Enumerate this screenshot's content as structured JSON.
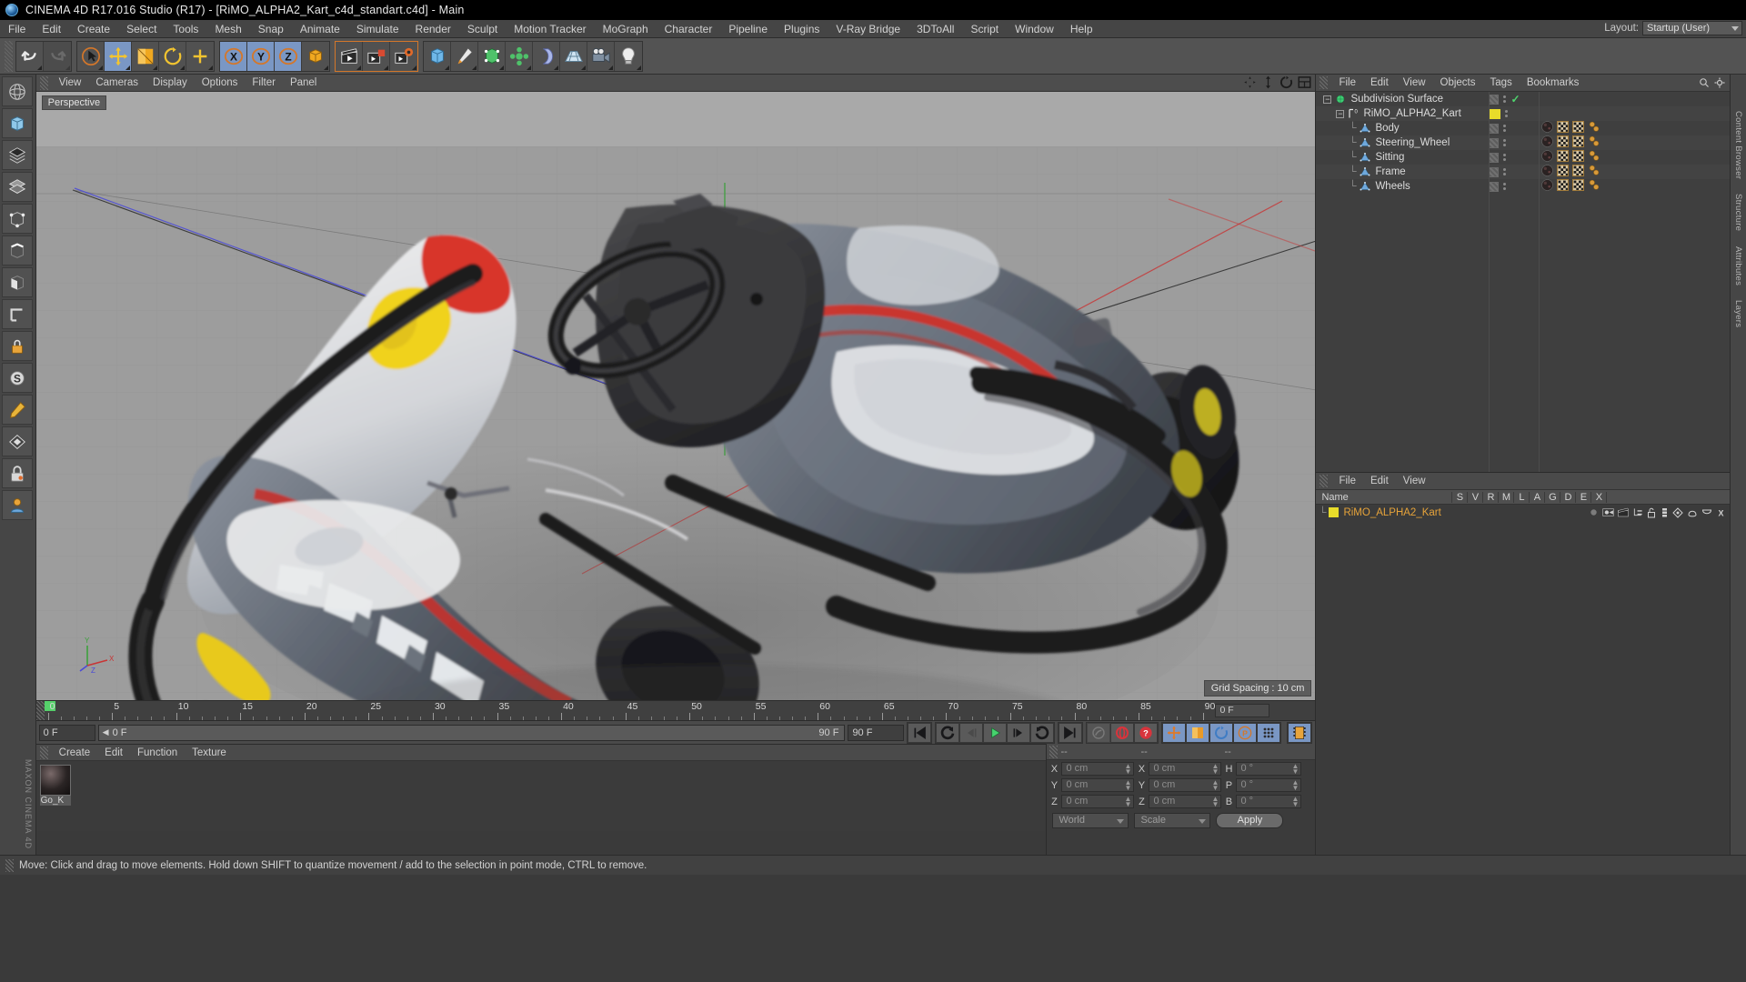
{
  "window": {
    "title": "CINEMA 4D R17.016 Studio (R17) - [RiMO_ALPHA2_Kart_c4d_standart.c4d] - Main",
    "app_icon": "c4d-logo-icon"
  },
  "menubar": {
    "items": [
      "File",
      "Edit",
      "Create",
      "Select",
      "Tools",
      "Mesh",
      "Snap",
      "Animate",
      "Simulate",
      "Render",
      "Sculpt",
      "Motion Tracker",
      "MoGraph",
      "Character",
      "Pipeline",
      "Plugins",
      "V-Ray Bridge",
      "3DToAll",
      "Script",
      "Window",
      "Help"
    ],
    "layout_label": "Layout:",
    "layout_value": "Startup (User)"
  },
  "toolbar": {
    "groups": [
      {
        "name": "history",
        "buttons": [
          {
            "name": "undo-button",
            "icon": "undo-arrow-icon"
          },
          {
            "name": "redo-button",
            "icon": "redo-arrow-icon"
          }
        ]
      },
      {
        "name": "transform",
        "buttons": [
          {
            "name": "select-tool-button",
            "icon": "cursor-arrow-icon"
          },
          {
            "name": "move-tool-button",
            "icon": "move-cross-icon",
            "active": true
          },
          {
            "name": "scale-tool-button",
            "icon": "scale-box-icon"
          },
          {
            "name": "rotate-tool-button",
            "icon": "rotate-circle-icon"
          },
          {
            "name": "axis-tool-button",
            "icon": "axis-cross-icon"
          }
        ]
      },
      {
        "name": "axis-lock",
        "buttons": [
          {
            "name": "lock-x-button",
            "icon": "x-axis-icon",
            "active": true
          },
          {
            "name": "lock-y-button",
            "icon": "y-axis-icon",
            "active": true
          },
          {
            "name": "lock-z-button",
            "icon": "z-axis-icon",
            "active": true
          },
          {
            "name": "world-coord-button",
            "icon": "world-cube-icon"
          }
        ]
      },
      {
        "name": "render",
        "buttons": [
          {
            "name": "render-view-button",
            "icon": "clapper-icon"
          },
          {
            "name": "render-to-picture-button",
            "icon": "clapper-picture-icon"
          },
          {
            "name": "render-settings-button",
            "icon": "clapper-gear-icon"
          }
        ]
      },
      {
        "name": "create",
        "buttons": [
          {
            "name": "add-cube-button",
            "icon": "cube-icon"
          },
          {
            "name": "spline-pen-button",
            "icon": "pen-icon"
          },
          {
            "name": "nurbs-button",
            "icon": "nurbs-green-icon"
          },
          {
            "name": "array-button",
            "icon": "array-green-icon"
          },
          {
            "name": "bend-deformer-button",
            "icon": "deformer-icon"
          },
          {
            "name": "floor-button",
            "icon": "floor-grid-icon"
          },
          {
            "name": "camera-button",
            "icon": "camera-icon"
          },
          {
            "name": "light-button",
            "icon": "lightbulb-icon"
          }
        ]
      }
    ]
  },
  "leftbar": {
    "buttons": [
      {
        "name": "live-selection-button",
        "icon": "sphere-mesh-icon"
      },
      {
        "name": "make-editable-button",
        "icon": "cube-editable-icon"
      },
      {
        "name": "model-mode-button",
        "icon": "model-checker-icon"
      },
      {
        "name": "texture-mode-button",
        "icon": "texture-layers-icon"
      },
      {
        "name": "points-mode-button",
        "icon": "points-icon"
      },
      {
        "name": "edges-mode-button",
        "icon": "edges-icon"
      },
      {
        "name": "polygons-mode-button",
        "icon": "polygons-icon"
      },
      {
        "name": "workplane-button",
        "icon": "workplane-icon"
      },
      {
        "name": "enable-axis-button",
        "icon": "axis-lock-icon"
      },
      {
        "name": "snap-button",
        "icon": "magnet-snap-icon"
      },
      {
        "name": "viewport-solo-button",
        "icon": "solo-icon"
      },
      {
        "name": "uv-mode-button",
        "icon": "uv-checker-icon"
      },
      {
        "name": "lock-button",
        "icon": "padlock-icon"
      },
      {
        "name": "animation-layer-button",
        "icon": "layer-anim-icon"
      }
    ],
    "brand": "MAXON CINEMA 4D"
  },
  "viewport": {
    "menu": [
      "View",
      "Cameras",
      "Display",
      "Options",
      "Filter",
      "Panel"
    ],
    "label": "Perspective",
    "grid_spacing": "Grid Spacing : 10 cm",
    "corner_icons": [
      "pan-icon",
      "zoom-icon",
      "rotate-icon",
      "maximize-icon"
    ],
    "axis_labels": {
      "y": "Y",
      "x": "X",
      "z": "Z"
    }
  },
  "timeline": {
    "ticks": [
      0,
      5,
      10,
      15,
      20,
      25,
      30,
      35,
      40,
      45,
      50,
      55,
      60,
      65,
      70,
      75,
      80,
      85,
      90
    ],
    "current_frame": "0 F",
    "current_frame_field": "0 F",
    "start_field": "0 F",
    "end_field": "90 F",
    "range_end": "90 F",
    "playback_buttons": [
      {
        "name": "goto-start-button",
        "icon": "skip-start-icon"
      },
      {
        "name": "step-back-keyframe-button",
        "icon": "prev-key-icon"
      },
      {
        "name": "step-back-frame-button",
        "icon": "step-back-icon"
      },
      {
        "name": "play-button",
        "icon": "play-triangle-icon"
      },
      {
        "name": "step-forward-frame-button",
        "icon": "step-forward-icon"
      },
      {
        "name": "next-keyframe-button",
        "icon": "next-key-icon"
      },
      {
        "name": "goto-end-button",
        "icon": "skip-end-icon"
      }
    ],
    "record_buttons": [
      {
        "name": "record-active-objects-button",
        "icon": "record-key-icon"
      },
      {
        "name": "autokeying-button",
        "icon": "autokey-red-icon"
      },
      {
        "name": "keyframe-selection-button",
        "icon": "question-red-icon"
      }
    ],
    "key_toggles": [
      {
        "name": "key-position-button",
        "icon": "position-cross-icon",
        "active": true
      },
      {
        "name": "key-scale-button",
        "icon": "scale-orange-icon",
        "active": true
      },
      {
        "name": "key-rotation-button",
        "icon": "rotation-blue-icon",
        "active": true
      },
      {
        "name": "key-param-button",
        "icon": "param-p-icon",
        "active": true
      },
      {
        "name": "key-pla-button",
        "icon": "pla-dots-icon",
        "active": true
      },
      {
        "name": "timeline-toggle-button",
        "icon": "filmstrip-icon",
        "active": true
      }
    ]
  },
  "material_manager": {
    "menu": [
      "Create",
      "Edit",
      "Function",
      "Texture"
    ],
    "materials": [
      {
        "name": "Go_K",
        "swatch": "#2a2424"
      }
    ]
  },
  "coordinates": {
    "header": [
      "--",
      "--",
      "--"
    ],
    "position": {
      "label_x": "X",
      "label_y": "Y",
      "label_z": "Z",
      "x": "0 cm",
      "y": "0 cm",
      "z": "0 cm"
    },
    "size": {
      "label_x": "X",
      "label_y": "Y",
      "label_z": "Z",
      "x": "0 cm",
      "y": "0 cm",
      "z": "0 cm"
    },
    "rotation": {
      "label_h": "H",
      "label_p": "P",
      "label_b": "B",
      "h": "0 °",
      "p": "0 °",
      "b": "0 °"
    },
    "coord_system": "World",
    "size_mode": "Scale",
    "apply_label": "Apply"
  },
  "object_manager": {
    "menu": [
      "File",
      "Edit",
      "View",
      "Objects",
      "Tags",
      "Bookmarks"
    ],
    "rows": [
      {
        "name": "Subdivision Surface",
        "depth": 0,
        "icon": "subdivision-surface-icon",
        "color": "#5ade8a",
        "enabled_check": true,
        "tags": []
      },
      {
        "name": "RiMO_ALPHA2_Kart",
        "depth": 1,
        "icon": "null-object-icon",
        "color": "#f2e03a",
        "swatch": "#e8dc2a",
        "tags": []
      },
      {
        "name": "Body",
        "depth": 2,
        "icon": "polygon-object-icon",
        "color": "#6fa8dc",
        "tags": [
          "material-tag",
          "uvw-tag",
          "texture-tag",
          "selection-tag"
        ]
      },
      {
        "name": "Steering_Wheel",
        "depth": 2,
        "icon": "polygon-object-icon",
        "color": "#6fa8dc",
        "tags": [
          "material-tag",
          "uvw-tag",
          "texture-tag",
          "selection-tag"
        ]
      },
      {
        "name": "Sitting",
        "depth": 2,
        "icon": "polygon-object-icon",
        "color": "#6fa8dc",
        "tags": [
          "material-tag",
          "uvw-tag",
          "texture-tag",
          "selection-tag"
        ]
      },
      {
        "name": "Frame",
        "depth": 2,
        "icon": "polygon-object-icon",
        "color": "#6fa8dc",
        "tags": [
          "material-tag",
          "uvw-tag",
          "texture-tag",
          "selection-tag"
        ]
      },
      {
        "name": "Wheels",
        "depth": 2,
        "icon": "polygon-object-icon",
        "color": "#6fa8dc",
        "tags": [
          "material-tag",
          "uvw-tag",
          "texture-tag",
          "selection-tag"
        ]
      }
    ]
  },
  "layer_manager": {
    "menu": [
      "File",
      "Edit",
      "View"
    ],
    "columns": [
      "Name",
      "S",
      "V",
      "R",
      "M",
      "L",
      "A",
      "G",
      "D",
      "E",
      "X"
    ],
    "rows": [
      {
        "name": "RiMO_ALPHA2_Kart",
        "color": "#e8dc2a",
        "text_color": "#e6a33a"
      }
    ]
  },
  "right_tabs": [
    "Content Browser",
    "Structure",
    "Attributes",
    "Layers"
  ],
  "statusbar": {
    "message": "Move: Click and drag to move elements. Hold down SHIFT to quantize movement / add to the selection in point mode, CTRL to remove."
  },
  "colors": {
    "accent_blue": "#7a97c4",
    "panel_bg": "#3f3f3f",
    "toolbar_bg": "#535353",
    "text": "#d2d2d2",
    "yellow": "#e8dc2a",
    "green": "#55d06a",
    "orange": "#e6a33a"
  }
}
